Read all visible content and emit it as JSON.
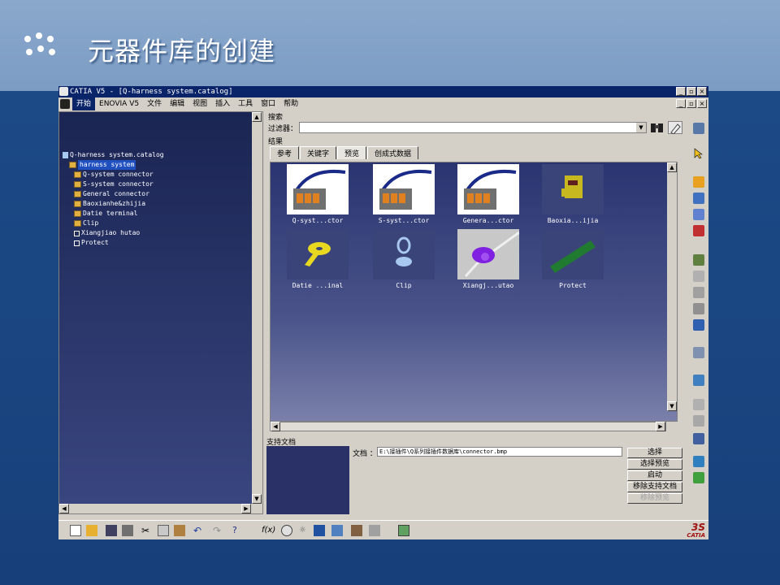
{
  "slide": {
    "title": "元器件库的创建"
  },
  "window": {
    "title": "CATIA V5 - [Q-harness system.catalog]",
    "controls": [
      "_",
      "▫",
      "×"
    ]
  },
  "menu": {
    "items": [
      "开始",
      "ENOVIA V5",
      "文件",
      "编辑",
      "视图",
      "插入",
      "工具",
      "窗口",
      "帮助"
    ]
  },
  "tree": {
    "nodes": [
      {
        "label": "Q-harness system.catalog"
      },
      {
        "label": "harness system"
      },
      {
        "label": "Q-system connector"
      },
      {
        "label": "S-system connector"
      },
      {
        "label": "General connector"
      },
      {
        "label": "Baoxianhe&zhijia"
      },
      {
        "label": "Datie terminal"
      },
      {
        "label": "Clip"
      },
      {
        "label": "Xiangjiao hutao"
      },
      {
        "label": "Protect"
      }
    ]
  },
  "search": {
    "section_label": "搜索",
    "filter_label": "过滤器：",
    "filter_value": "",
    "results_label": "结果"
  },
  "tabs": [
    {
      "label": "参考"
    },
    {
      "label": "关键字"
    },
    {
      "label": "预览"
    },
    {
      "label": "创成式数据"
    }
  ],
  "preview_items": [
    {
      "caption": "Q-syst...ctor"
    },
    {
      "caption": "S-syst...ctor"
    },
    {
      "caption": "Genera...ctor"
    },
    {
      "caption": "Baoxia...ijia"
    },
    {
      "caption": "Datie ...inal"
    },
    {
      "caption": "Clip"
    },
    {
      "caption": "Xiangj...utao"
    },
    {
      "caption": "Protect"
    }
  ],
  "doc": {
    "section_label": "支持文档",
    "path_label": "文档 ：",
    "path_value": "E:\\接插件\\Q系列接插件数据库\\connector.bmp",
    "buttons": [
      {
        "label": "选择"
      },
      {
        "label": "选择预览"
      },
      {
        "label": "启动"
      },
      {
        "label": "移除支持文档"
      },
      {
        "label": "移除预览"
      }
    ]
  },
  "brand": {
    "logo_text": "CATIA"
  },
  "colors": {
    "slide_header": "#7d9cc4",
    "slide_body": "#1c4a86",
    "window_title": "#0a246a",
    "panel_bg": "#2a3470"
  }
}
